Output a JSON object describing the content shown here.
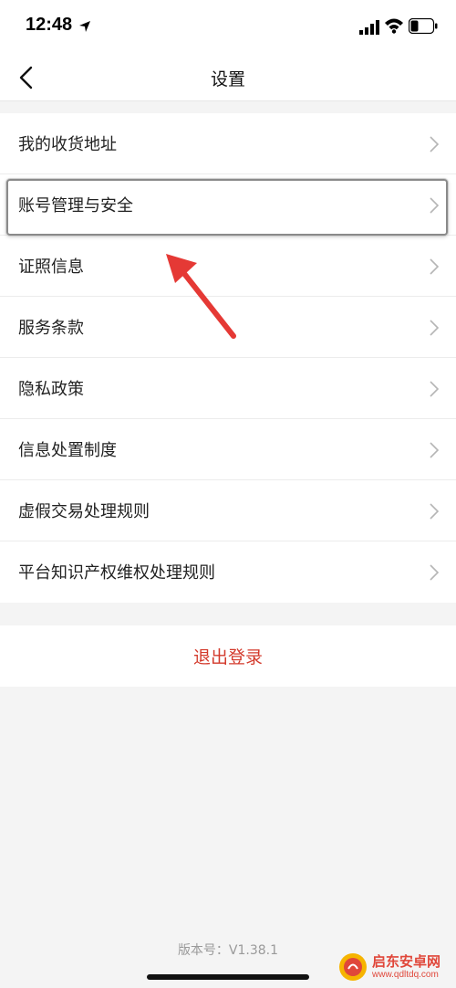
{
  "status_bar": {
    "time": "12:48",
    "icons": [
      "location-icon",
      "signal-icon",
      "wifi-icon",
      "battery-icon"
    ],
    "battery_level": 0.35
  },
  "nav": {
    "title": "设置",
    "back_icon": "chevron-left-icon"
  },
  "settings": {
    "items": [
      {
        "label": "我的收货地址"
      },
      {
        "label": "账号管理与安全"
      },
      {
        "label": "证照信息"
      },
      {
        "label": "服务条款"
      },
      {
        "label": "隐私政策"
      },
      {
        "label": "信息处置制度"
      },
      {
        "label": "虚假交易处理规则"
      },
      {
        "label": "平台知识产权维权处理规则"
      }
    ],
    "highlighted_index": 1
  },
  "logout": {
    "label": "退出登录"
  },
  "footer": {
    "version": "版本号：V1.38.1"
  },
  "watermark": {
    "name": "启东安卓网",
    "url": "www.qdltdq.com"
  },
  "colors": {
    "accent_red": "#d33a2c",
    "background": "#f4f4f4",
    "annotation_arrow": "#e53935"
  }
}
